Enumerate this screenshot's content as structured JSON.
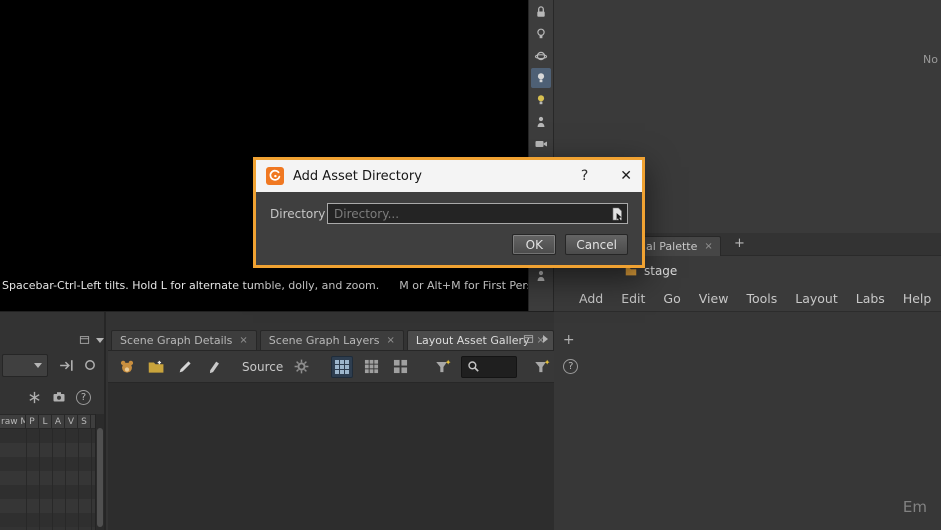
{
  "dialog": {
    "title": "Add Asset Directory",
    "help": "?",
    "close": "✕",
    "field_label": "Directory",
    "field_placeholder": "Directory...",
    "ok": "OK",
    "cancel": "Cancel"
  },
  "viewport": {
    "status_left": "Spacebar-Ctrl-Left tilts. Hold L for alternate tumble, dolly, and zoom.",
    "status_right": "M or Alt+M for First Person"
  },
  "right_panel": {
    "truncated_text": "No",
    "palette_tab": "al Palette",
    "palette_tab_close": "×",
    "add_tab": "+",
    "stage_label": "stage",
    "menu": [
      "Add",
      "Edit",
      "Go",
      "View",
      "Tools",
      "Layout",
      "Labs",
      "Help"
    ],
    "empty_text": "Em"
  },
  "bottom_panel": {
    "tabs": [
      {
        "label": "Scene Graph Details",
        "close": "×"
      },
      {
        "label": "Scene Graph Layers",
        "close": "×"
      },
      {
        "label": "Layout Asset Gallery",
        "close": "×"
      }
    ],
    "add_tab": "+",
    "source_label": "Source",
    "table_headers": [
      "raw M",
      "P",
      "L",
      "A",
      "V",
      "S"
    ],
    "help": "?"
  },
  "icons": {
    "dialog_logo": "houdini-logo",
    "vertical_strip": [
      "lock",
      "bulb",
      "sphere",
      "bulb-selected",
      "bulb-on",
      "person",
      "camera"
    ],
    "gallery_toolbar": [
      "teddy-bear",
      "folder-add",
      "pencil",
      "pen",
      "gear",
      "grid-large",
      "grid-medium",
      "grid-list",
      "filter-funnel-star",
      "magnifier",
      "help"
    ],
    "colors": {
      "accent_orange": "#f0a232",
      "logo_orange": "#f07821",
      "selected_blue": "#4e6075"
    }
  }
}
